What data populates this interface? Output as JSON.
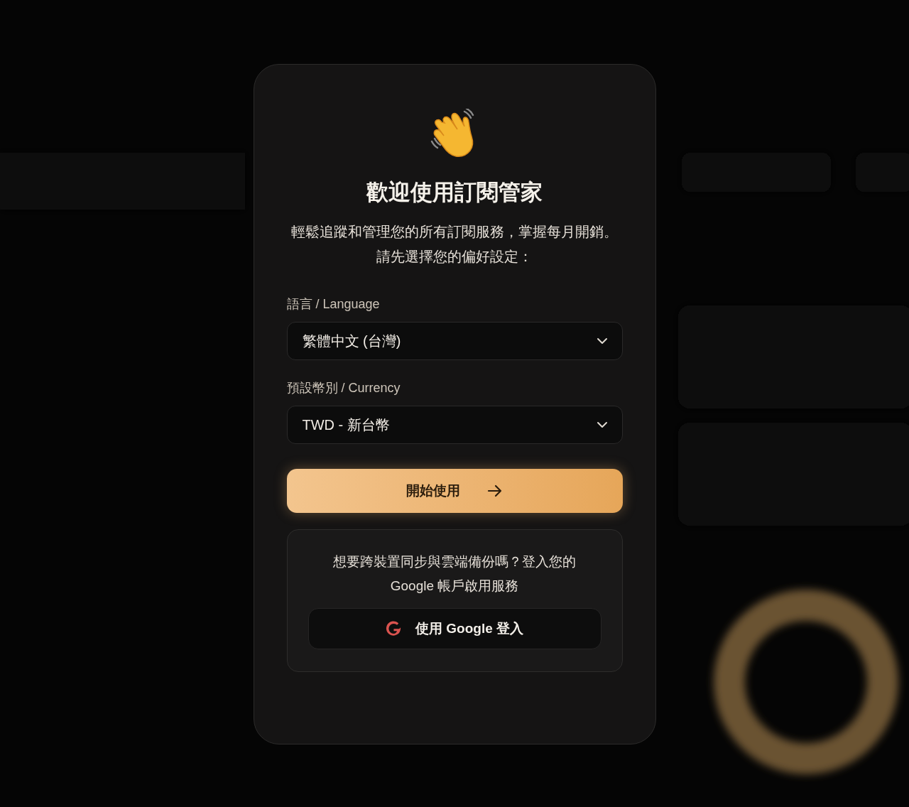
{
  "dialog": {
    "title": "歡迎使用訂閱管家",
    "description": "輕鬆追蹤和管理您的所有訂閱服務，掌握每月開銷。請先選擇您的偏好設定：",
    "fields": [
      {
        "label": "語言 / Language",
        "value": "繁體中文 (台灣)"
      },
      {
        "label": "預設幣別 / Currency",
        "value": "TWD - 新台幣"
      }
    ],
    "start_button": "開始使用",
    "sync": {
      "text": "想要跨裝置同步與雲端備份嗎？登入您的 Google 帳戶啟用服務",
      "button": "使用 Google 登入"
    }
  }
}
